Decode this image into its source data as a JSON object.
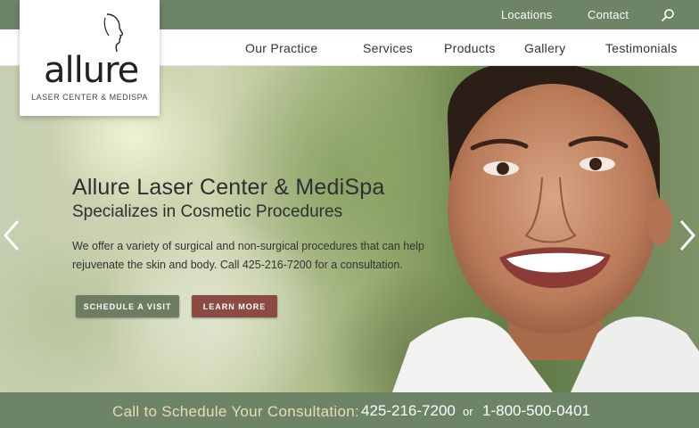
{
  "header": {
    "top_links": [
      "Locations",
      "Contact"
    ],
    "nav": [
      "Our Practice",
      "Services",
      "Products",
      "Gallery",
      "Testimonials"
    ]
  },
  "logo": {
    "name": "allure",
    "tagline": "LASER CENTER & MEDISPA"
  },
  "hero": {
    "title": "Allure Laser Center & MediSpa",
    "subtitle": "Specializes in Cosmetic Procedures",
    "body": "We offer a variety of surgical and non-surgical procedures that can help rejuvenate the skin and body. Call 425-216-7200 for a consultation.",
    "buttons": {
      "schedule": "SCHEDULE A VISIT",
      "learn": "LEARN MORE"
    }
  },
  "footer": {
    "label": "Call to Schedule Your Consultation:",
    "phone1": "425-216-7200",
    "or": "or",
    "phone2": "1-800-500-0401"
  },
  "colors": {
    "brand_green": "#6e8467",
    "button_green": "#6e7d62",
    "button_red": "#8b4b42",
    "footer_label": "#e8dcb4"
  },
  "icons": [
    "search-icon",
    "chevron-left-icon",
    "chevron-right-icon",
    "face-profile-icon"
  ]
}
